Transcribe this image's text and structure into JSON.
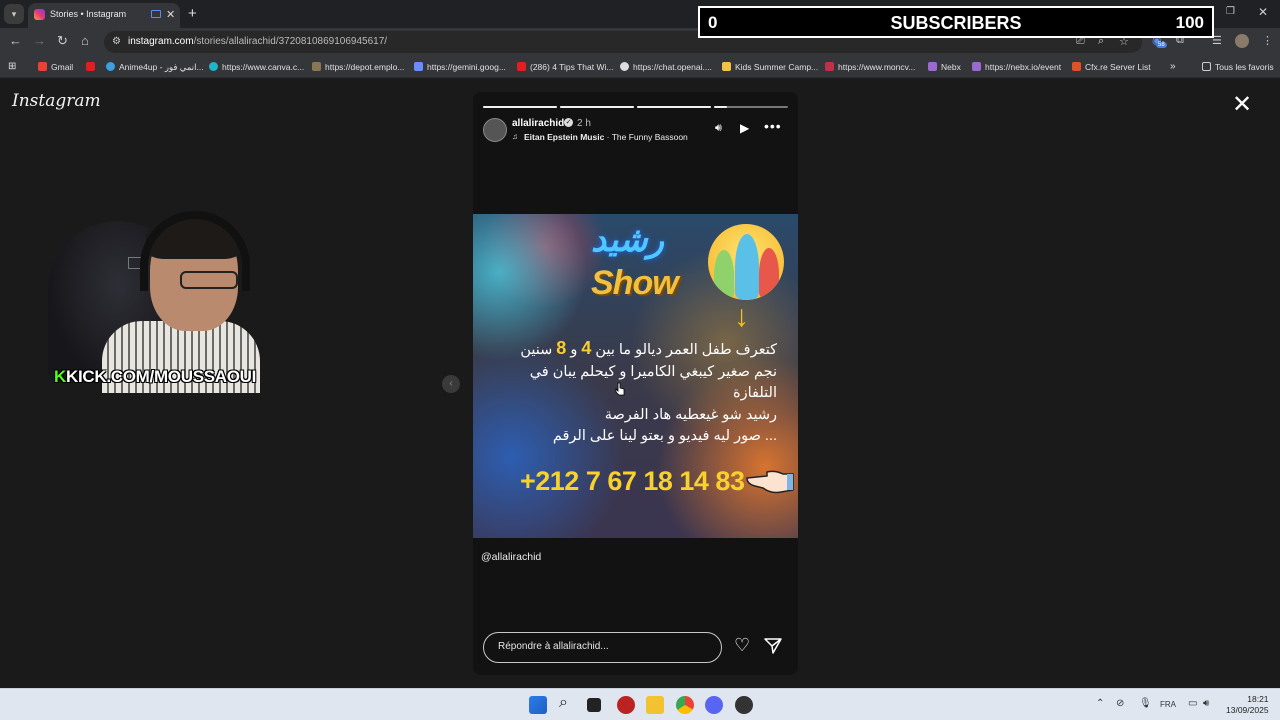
{
  "browser": {
    "tab_title": "Stories • Instagram",
    "url_host": "instagram.com",
    "url_path": "/stories/allalirachid/3720810869106945617/",
    "bookmarks": [
      "Gmail",
      "Anime4up - انمي فور...",
      "https://www.canva.c...",
      "https://depot.emplo...",
      "https://gemini.goog...",
      "(286) 4 Tips That Wi...",
      "https://chat.openai....",
      "Kids Summer Camp...",
      "https://www.moncv...",
      "Nebx",
      "https://nebx.io/event",
      "Cfx.re Server List"
    ],
    "all_bookmarks": "Tous les favoris",
    "extension_badge": "58"
  },
  "overlay": {
    "left_count": "0",
    "label": "SUBSCRIBERS",
    "right_count": "100"
  },
  "page": {
    "logo": "Instagram",
    "webcam_text_k": "K",
    "webcam_text": "KICK.COM/MOUSSAOUI"
  },
  "story": {
    "username": "allalirachid",
    "time": "2 h",
    "music_artist": "Eitan Epstein Music",
    "music_sep": " · ",
    "music_track": "The Funny Bassoon",
    "progress": [
      1.0,
      1.0,
      1.0,
      0.18
    ],
    "image": {
      "logo_ar": "رشيد",
      "logo_show": "Show",
      "line1_a": "كتعرف طفل العمر ديالو ما بين ",
      "line1_n1": "4",
      "line1_b": " و ",
      "line1_n2": "8",
      "line1_c": " سنين",
      "line2": "نجم صغير كيبغي الكاميرا و كيحلم يبان في",
      "line3": "التلفازة",
      "line4": "رشيد شو غيعطيه هاد الفرصة",
      "line5": "... صور ليه فيديو و بعتو لينا على الرقم",
      "phone": "+212 7 67 18 14 83"
    },
    "mention": "@allalirachid",
    "reply_placeholder": "Répondre à allalirachid..."
  },
  "taskbar": {
    "lang": "FRA",
    "time": "18:21",
    "date": "13/09/2025"
  },
  "colors": {
    "accent_yellow": "#f7d22c",
    "kick_green": "#53fc18"
  }
}
